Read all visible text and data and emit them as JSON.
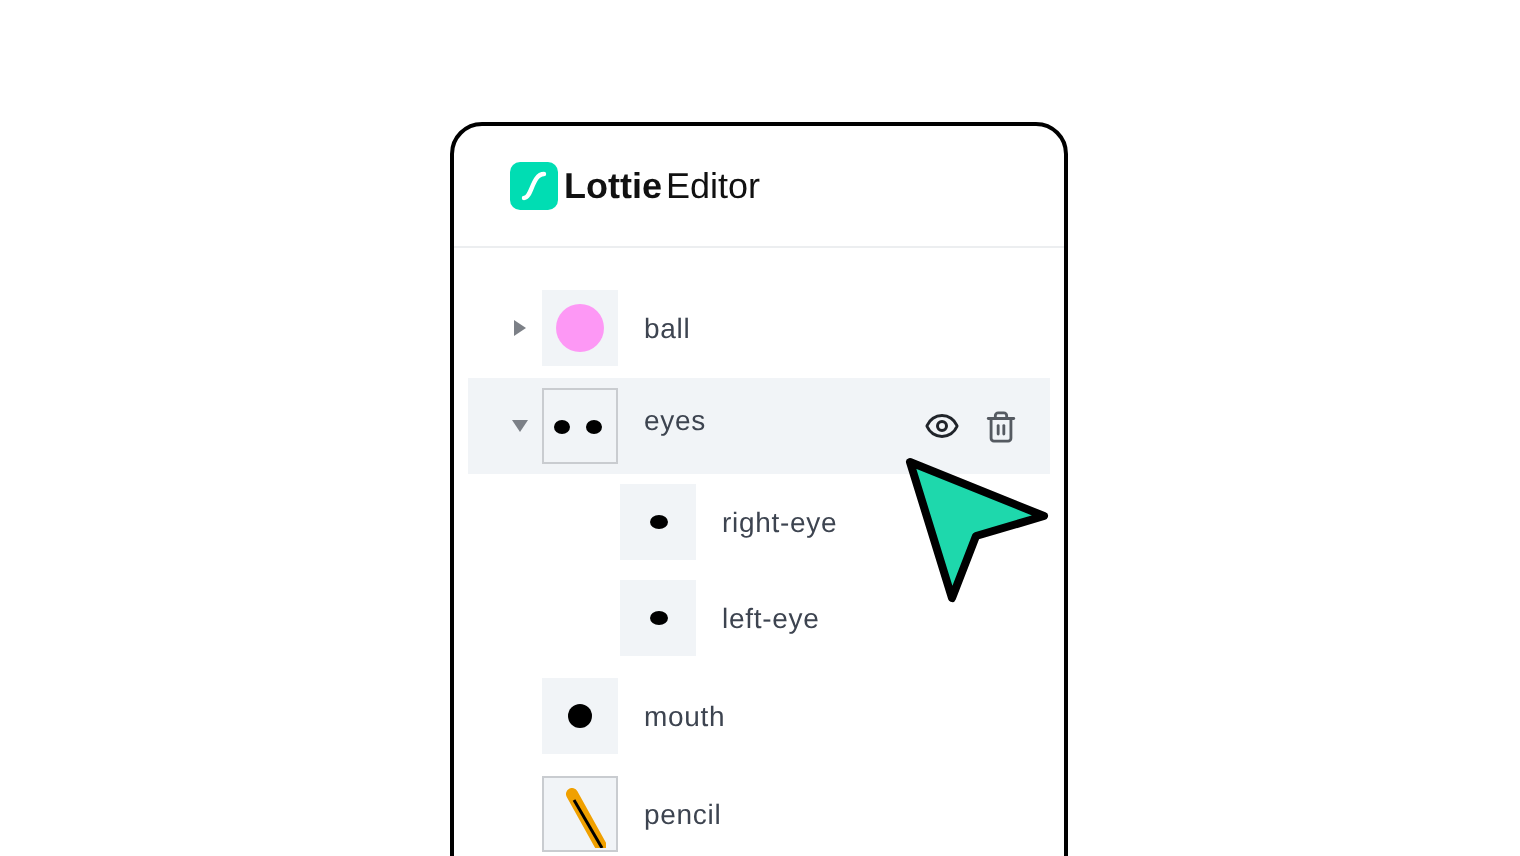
{
  "logo": {
    "bold": "Lottie",
    "light": "Editor"
  },
  "layers": [
    {
      "name": "ball",
      "kind": "ball",
      "expanded": false,
      "selected": false
    },
    {
      "name": "eyes",
      "kind": "eyes",
      "expanded": true,
      "selected": true,
      "children": [
        {
          "name": "right-eye",
          "kind": "eye",
          "selected": false
        },
        {
          "name": "left-eye",
          "kind": "eye",
          "selected": false
        }
      ]
    },
    {
      "name": "mouth",
      "kind": "dot",
      "selected": false
    },
    {
      "name": "pencil",
      "kind": "pencil",
      "selected": false
    }
  ]
}
